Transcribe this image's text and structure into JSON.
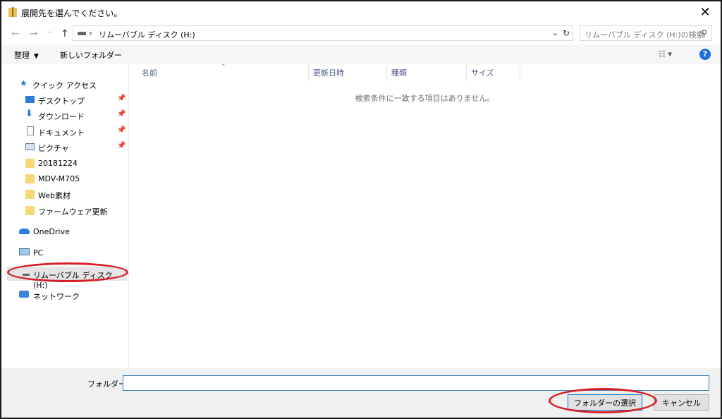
{
  "dialog": {
    "title": "展開先を選んでください。",
    "close_glyph": "✕"
  },
  "nav": {
    "back_glyph": "←",
    "forward_glyph": "→",
    "recent_glyph": "⌄",
    "up_glyph": "↑",
    "address_sep": "›",
    "address": "リムーバブル ディスク (H:)",
    "address_dropdown_glyph": "⌄",
    "refresh_glyph": "↻",
    "search_placeholder": "リムーバブル ディスク (H:)の検索",
    "search_glyph": "⚲"
  },
  "toolbar": {
    "organize": "整理",
    "organize_caret": "▼",
    "new_folder": "新しいフォルダー",
    "view_glyph": "☷ ▾",
    "help": "?"
  },
  "sidebar": {
    "quick_access": "クイック アクセス",
    "items": [
      {
        "label": "デスクトップ",
        "icon": "desktop-icon",
        "pinned": true
      },
      {
        "label": "ダウンロード",
        "icon": "download-icon",
        "pinned": true
      },
      {
        "label": "ドキュメント",
        "icon": "document-icon",
        "pinned": true
      },
      {
        "label": "ピクチャ",
        "icon": "picture-icon",
        "pinned": true
      },
      {
        "label": "20181224",
        "icon": "folder-icon",
        "pinned": false
      },
      {
        "label": "MDV-M705",
        "icon": "folder-icon",
        "pinned": false
      },
      {
        "label": "Web素材",
        "icon": "folder-icon",
        "pinned": false
      },
      {
        "label": "ファームウェア更新",
        "icon": "folder-icon",
        "pinned": false
      }
    ],
    "pin_glyph": "📌",
    "onedrive": "OneDrive",
    "pc": "PC",
    "removable": "リムーバブル ディスク (H:)",
    "network": "ネットワーク"
  },
  "filelist": {
    "columns": [
      "名前",
      "更新日時",
      "種類",
      "サイズ"
    ],
    "sort_glyph": "⌃",
    "empty_message": "検索条件に一致する項目はありません。"
  },
  "footer": {
    "folder_label": "フォルダー:",
    "folder_value": "",
    "select_button": "フォルダーの選択",
    "cancel_button": "キャンセル"
  },
  "colors": {
    "annotation": "#d61f26",
    "selection": "#e5e5e5",
    "help": "#1e6fd6",
    "folder": "#f8d775"
  }
}
